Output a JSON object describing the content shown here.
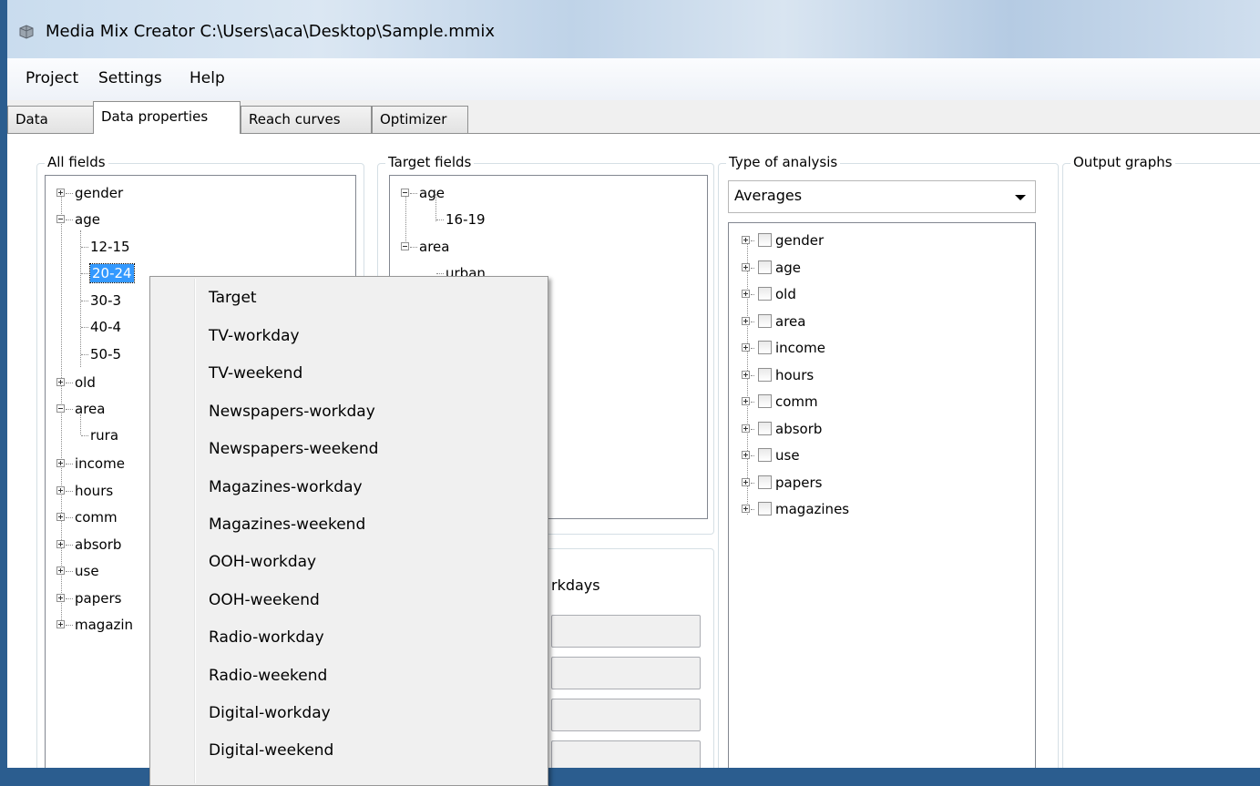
{
  "window": {
    "title": "Media Mix Creator C:\\Users\\aca\\Desktop\\Sample.mmix"
  },
  "menu": [
    "Project",
    "Settings",
    "Help"
  ],
  "tabs": [
    "Data",
    "Data properties",
    "Reach curves",
    "Optimizer"
  ],
  "active_tab": "Data properties",
  "all_fields": {
    "title": "All fields",
    "items": [
      "gender",
      "age",
      "12-15",
      "20-24",
      "30-3",
      "40-4",
      "50-5",
      "old",
      "area",
      "rura",
      "income",
      "hours",
      "comm",
      "absorb",
      "use",
      "papers",
      "magazin"
    ],
    "selected": "20-24"
  },
  "target_fields": {
    "title": "Target fields",
    "items": [
      "age",
      "16-19",
      "area",
      "urban"
    ]
  },
  "lower_panel": {
    "label": "rkdays"
  },
  "type_of_analysis": {
    "title": "Type of analysis",
    "selected": "Averages",
    "items": [
      "gender",
      "age",
      "old",
      "area",
      "income",
      "hours",
      "comm",
      "absorb",
      "use",
      "papers",
      "magazines"
    ]
  },
  "output_graphs": {
    "title": "Output graphs"
  },
  "context_menu": {
    "items": [
      "Target",
      "TV-workday",
      "TV-weekend",
      "Newspapers-workday",
      "Newspapers-weekend",
      "Magazines-workday",
      "Magazines-weekend",
      "OOH-workday",
      "OOH-weekend",
      "Radio-workday",
      "Radio-weekend",
      "Digital-workday",
      "Digital-weekend"
    ]
  }
}
